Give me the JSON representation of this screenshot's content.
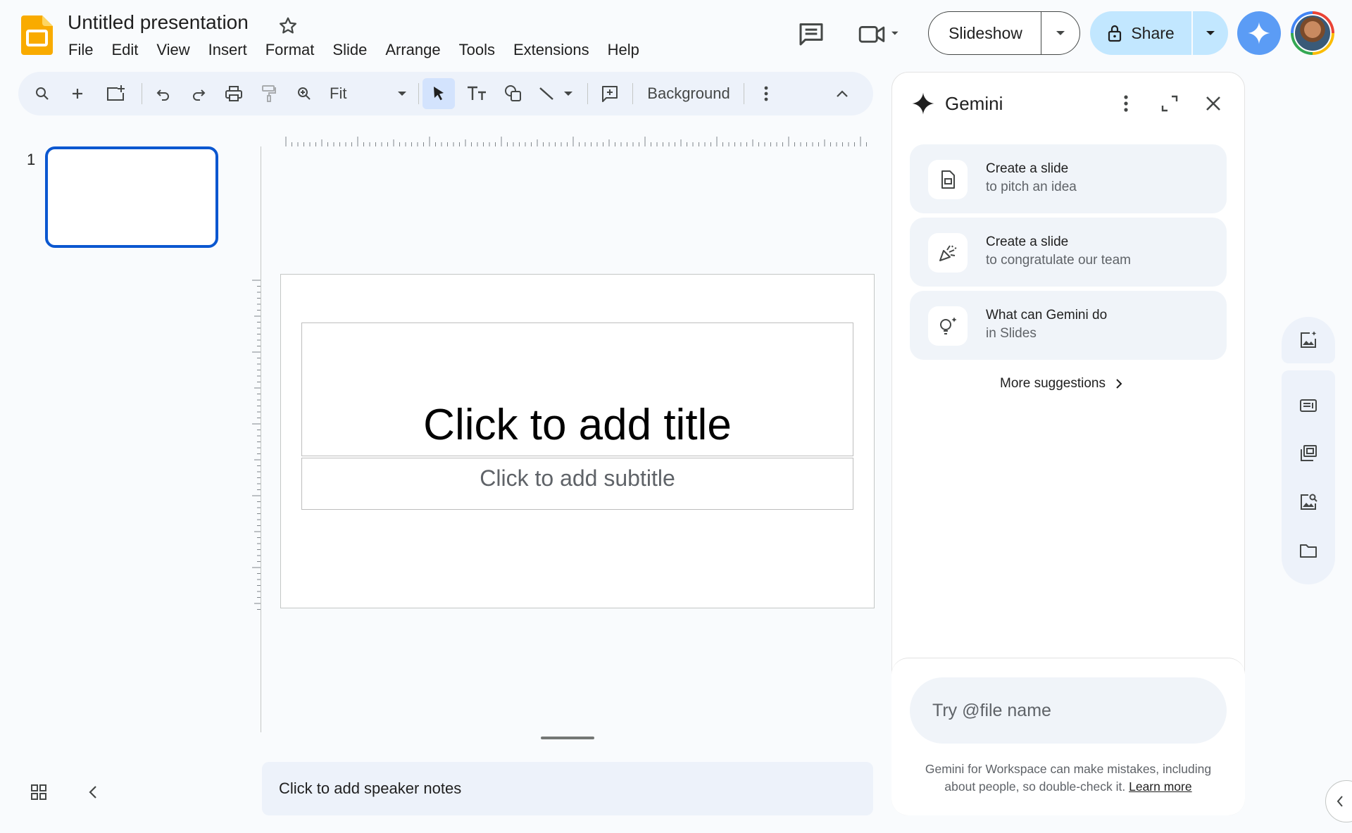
{
  "header": {
    "title": "Untitled presentation",
    "menu": [
      "File",
      "Edit",
      "View",
      "Insert",
      "Format",
      "Slide",
      "Arrange",
      "Tools",
      "Extensions",
      "Help"
    ],
    "slideshow_label": "Slideshow",
    "share_label": "Share"
  },
  "toolbar": {
    "zoom_value": "Fit",
    "background_label": "Background"
  },
  "filmstrip": {
    "slide_number": "1"
  },
  "slide": {
    "title_placeholder": "Click to add title",
    "subtitle_placeholder": "Click to add subtitle"
  },
  "notes": {
    "placeholder": "Click to add speaker notes"
  },
  "gemini": {
    "title": "Gemini",
    "suggestions": [
      {
        "line1": "Create a slide",
        "line2": "to pitch an idea",
        "icon": "slide-doc-icon"
      },
      {
        "line1": "Create a slide",
        "line2": "to congratulate our team",
        "icon": "party-popper-icon"
      },
      {
        "line1": "What can Gemini do",
        "line2": "in Slides",
        "icon": "lightbulb-sparkle-icon"
      }
    ],
    "more_suggestions": "More suggestions",
    "input_placeholder": "Try @file name",
    "disclaimer": "Gemini for Workspace can make mistakes, including about people, so double-check it.",
    "learn_more": "Learn more"
  },
  "colors": {
    "accent": "#0b57d0",
    "share_bg": "#c2e7ff",
    "toolbar_bg": "#edf2fa"
  }
}
